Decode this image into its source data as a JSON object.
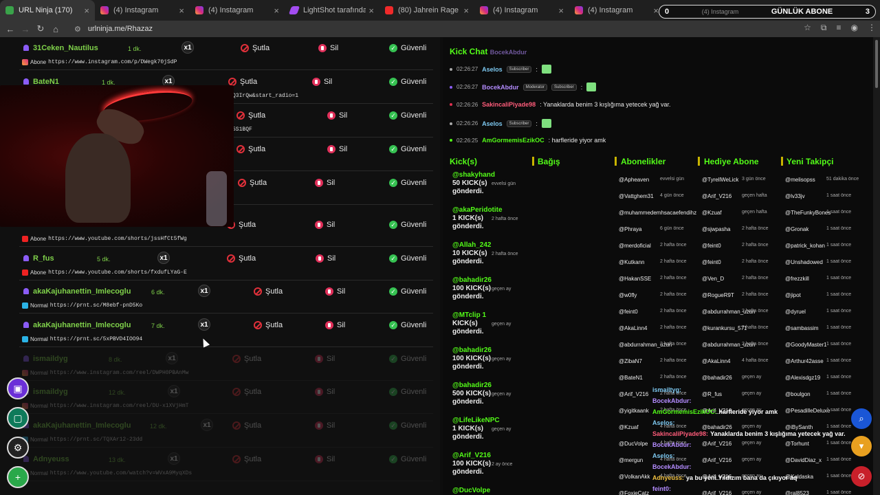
{
  "tabs": [
    {
      "title": "URL Ninja (170)",
      "fav": "un"
    },
    {
      "title": "(4) Instagram",
      "fav": "ig"
    },
    {
      "title": "(4) Instagram",
      "fav": "ig"
    },
    {
      "title": "LightShot tarafından Ekra",
      "fav": "ls"
    },
    {
      "title": "(80) Jahrein Rage | - YouT",
      "fav": "yt"
    },
    {
      "title": "(4) Instagram",
      "fav": "ig"
    },
    {
      "title": "(4) Instagram",
      "fav": "ig"
    }
  ],
  "sub_counter": {
    "left": "0",
    "label": "GÜNLÜK ABONE",
    "right": "3",
    "overlay_tab": "(4) Instagram"
  },
  "address": {
    "url": "urlninja.me/Rhazaz"
  },
  "actions": {
    "multiplier": "x1",
    "timeout": "Şutla",
    "delete": "Sil",
    "trust": "Güvenli"
  },
  "link_rows": [
    {
      "user": "31Ceken_Nautilus",
      "time": "1 dk.",
      "type": "Abone",
      "url": "https://www.instagram.com/p/DWegk70jSdP",
      "icon": "ig"
    },
    {
      "user": "BateN1",
      "time": "1 dk.",
      "type": "",
      "url": "Q3IrQw&start_radio=1",
      "icon": ""
    },
    {
      "user": "",
      "time": "",
      "type": "",
      "url": "5S1BQF",
      "icon": ""
    },
    {
      "user": "",
      "time": "",
      "type": "",
      "url": "",
      "icon": ""
    },
    {
      "user": "",
      "time": "",
      "type": "",
      "url": "",
      "icon": ""
    },
    {
      "user": "",
      "time": "",
      "type": "Abone",
      "url": "https://www.youtube.com/shorts/jssHfCt5fWg",
      "icon": "yt"
    },
    {
      "user": "R_fus",
      "time": "5 dk.",
      "type": "Abone",
      "url": "https://www.youtube.com/shorts/fxdufLYaG-E",
      "icon": "yt"
    },
    {
      "user": "akaKajuhanettin_Imlecoglu",
      "time": "6 dk.",
      "type": "Normal",
      "url": "https://prnt.sc/M8ebf-pnD5Ko",
      "icon": "pr"
    },
    {
      "user": "akaKajuhanettin_Imlecoglu",
      "time": "7 dk.",
      "type": "Normal",
      "url": "https://prnt.sc/5xPBVD4IOO94",
      "icon": "pr"
    },
    {
      "user": "ismaildyg",
      "time": "8 dk.",
      "type": "Normal",
      "url": "https://www.instagram.com/reel/DWPH0PBAnMw",
      "icon": "ig"
    },
    {
      "user": "ismaildyg",
      "time": "12 dk.",
      "type": "Normal",
      "url": "https://www.instagram.com/reel/DU-x1XVjHmT",
      "icon": "ig"
    },
    {
      "user": "akaKajuhanettin_Imlecoglu",
      "time": "12 dk.",
      "type": "Normal",
      "url": "https://prnt.sc/TQXAr12-23dd",
      "icon": "pr"
    },
    {
      "user": "Adnyeuss",
      "time": "13 dk.",
      "type": "Normal",
      "url": "https://www.youtube.com/watch?v=WVxA9MyqXDs",
      "icon": "yt"
    },
    {
      "user": "",
      "time": "",
      "type": "",
      "url": "",
      "icon": ""
    }
  ],
  "chat": {
    "title": "Kick Chat",
    "header_user": "BocekAbdur",
    "messages": [
      {
        "time": "02:26:27",
        "user": "Aselos",
        "color": "#7dc8f0",
        "badges": [
          "Subscriber"
        ],
        "text": ":",
        "emote": true,
        "dot": "#aaa"
      },
      {
        "time": "02:26:27",
        "user": "BocekAbdur",
        "color": "#b48cff",
        "badges": [
          "Moderator",
          "Subscriber"
        ],
        "text": ":",
        "emote": true,
        "dot": "#8b5cf6"
      },
      {
        "time": "02:26:26",
        "user": "SakincaliPiyade98",
        "color": "#ff5c7a",
        "badges": [],
        "text": ": Yanaklarda benim 3 kışlığıma yetecek yağ var.",
        "emote": false,
        "dot": "#e03050"
      },
      {
        "time": "02:26:26",
        "user": "Aselos",
        "color": "#7dc8f0",
        "badges": [
          "Subscriber"
        ],
        "text": ":",
        "emote": true,
        "dot": "#aaa"
      },
      {
        "time": "02:26:25",
        "user": "AmGormemisEzikOC",
        "color": "#53fc18",
        "badges": [],
        "text": ": harfleride yiyor amk",
        "emote": false,
        "dot": "#53fc18"
      }
    ]
  },
  "columns": {
    "kicks": "Kick(s)",
    "donations": "Bağış",
    "subs": "Abonelikler",
    "gift": "Hediye Abone",
    "follow": "Yeni Takipçi"
  },
  "kicks": [
    {
      "name": "@shakyhand",
      "line1": "50 KICK(s)",
      "line2": "gönderdi.",
      "time": "evvelsi gün"
    },
    {
      "name": "@akaPeridotite",
      "line1": "1 KICK(s)",
      "line2": "gönderdi.",
      "time": "2 hafta önce"
    },
    {
      "name": "@Allah_242",
      "line1": "10 KICK(s)",
      "line2": "gönderdi.",
      "time": "2 hafta önce"
    },
    {
      "name": "@bahadir26",
      "line1": "100 KICK(s)",
      "line2": "gönderdi.",
      "time": "geçen ay"
    },
    {
      "name": "@MTclip 1",
      "line1": "KICK(s)",
      "line2": "gönderdi.",
      "time": "geçen ay"
    },
    {
      "name": "@bahadir26",
      "line1": "100 KICK(s)",
      "line2": "gönderdi.",
      "time": "geçen ay"
    },
    {
      "name": "@bahadir26",
      "line1": "500 KICK(s)",
      "line2": "gönderdi.",
      "time": "geçen ay"
    },
    {
      "name": "@LifeLikeNPC",
      "line1": "1 KICK(s)",
      "line2": "gönderdi.",
      "time": "geçen ay"
    },
    {
      "name": "@Arif_V216",
      "line1": "100 KICK(s)",
      "line2": "gönderdi.",
      "time": "2 ay önce"
    },
    {
      "name": "@DucVolpe",
      "line1": "",
      "line2": "",
      "time": ""
    }
  ],
  "subs": [
    [
      "@Apheaven",
      "evvelsi gün"
    ],
    [
      "@Vattghem31",
      "4 gün önce"
    ],
    [
      "@muhammedemhsacaefendihz",
      ""
    ],
    [
      "@Phraya",
      "6 gün önce"
    ],
    [
      "@merdoficial",
      "2 hafta önce"
    ],
    [
      "@Kutkann",
      "2 hafta önce"
    ],
    [
      "@HakanSSE",
      "2 hafta önce"
    ],
    [
      "@w0fly",
      "2 hafta önce"
    ],
    [
      "@feint0",
      "2 hafta önce"
    ],
    [
      "@AkaLinn4",
      "2 hafta önce"
    ],
    [
      "@abdurrahman_uzun",
      "2 hafta önce"
    ],
    [
      "@ZibaN7",
      "2 hafta önce"
    ],
    [
      "@BateN1",
      "2 hafta önce"
    ],
    [
      "@Arif_V216",
      "2 hafta önce"
    ],
    [
      "@yigitkaank",
      "2 hafta önce"
    ],
    [
      "@Kzuaf",
      "4 hafta önce"
    ],
    [
      "@DucVolpe",
      "4 hafta önce"
    ],
    [
      "@mergun",
      "4 hafta önce"
    ],
    [
      "@VolkanAkk",
      "4 hafta önce"
    ],
    [
      "@FoxieCatz",
      ""
    ]
  ],
  "gifts": [
    [
      "@TyrellWeLick",
      "3 gün önce"
    ],
    [
      "@Arif_V216",
      "geçen hafta"
    ],
    [
      "@Kzuaf",
      "geçen hafta"
    ],
    [
      "@sjwpasha",
      "2 hafta önce"
    ],
    [
      "@feint0",
      "2 hafta önce"
    ],
    [
      "@feint0",
      "2 hafta önce"
    ],
    [
      "@Ven_D",
      "2 hafta önce"
    ],
    [
      "@RogueR9T",
      "2 hafta önce"
    ],
    [
      "@abdurrahman_uzun",
      "2 hafta önce"
    ],
    [
      "@kurankursu_571",
      "2 hafta önce"
    ],
    [
      "@abdurrahman_uzun",
      "2 hafta önce"
    ],
    [
      "@AkaLinn4",
      "4 hafta önce"
    ],
    [
      "@bahadir26",
      "geçen ay"
    ],
    [
      "@R_fus",
      "geçen ay"
    ],
    [
      "@Arif_V216",
      "geçen ay"
    ],
    [
      "@bahadir26",
      "geçen ay"
    ],
    [
      "@Arif_V216",
      "geçen ay"
    ],
    [
      "@Arif_V216",
      "geçen ay"
    ],
    [
      "@Arif_V216",
      "geçen ay"
    ],
    [
      "@Arif_V216",
      "geçen ay"
    ]
  ],
  "follows": [
    [
      "@melisopss",
      "51 dakika önce"
    ],
    [
      "@lv33jv",
      "1 saat önce"
    ],
    [
      "@TheFunkyBones",
      "1 saat önce"
    ],
    [
      "@Gronak",
      "1 saat önce"
    ],
    [
      "@patrick_kohan",
      "1 saat önce"
    ],
    [
      "@Unshadowed",
      "1 saat önce"
    ],
    [
      "@frezzkill",
      "1 saat önce"
    ],
    [
      "@jipot",
      "1 saat önce"
    ],
    [
      "@dyruel",
      "1 saat önce"
    ],
    [
      "@sambassim",
      "1 saat önce"
    ],
    [
      "@GoodyMaster1",
      "1 saat önce"
    ],
    [
      "@Arthur42asse",
      "1 saat önce"
    ],
    [
      "@Alexisdgz19",
      "1 saat önce"
    ],
    [
      "@boulgon",
      "1 saat önce"
    ],
    [
      "@PesadilleDeluxe",
      "1 saat önce"
    ],
    [
      "@iBySanth",
      "1 saat önce"
    ],
    [
      "@Torhunt",
      "1 saat önce"
    ],
    [
      "@DavidDiaz_x",
      "1 saat önce"
    ],
    [
      "@Kaldaska",
      "1 saat önce"
    ],
    [
      "@ral8523",
      "1 saat önce"
    ]
  ],
  "overlay_chat": [
    {
      "user": "ismailtyg:",
      "text": "",
      "color": "#7dc8f0"
    },
    {
      "user": "BocekAbdur:",
      "text": "",
      "color": "#b48cff"
    },
    {
      "user": "AmGormemisEzikOC:",
      "text": "harfleride yiyor amk",
      "color": "#53fc18"
    },
    {
      "user": "Aselos:",
      "text": "",
      "color": "#7dc8f0"
    },
    {
      "user": "SakincaliPiyade98:",
      "text": "Yanaklarda benim 3 kışlığıma yetecek yağ var.",
      "color": "#ff5c7a"
    },
    {
      "user": "BocekAbdur:",
      "text": "",
      "color": "#b48cff"
    },
    {
      "user": "Aselos:",
      "text": "",
      "color": "#7dc8f0"
    },
    {
      "user": "BocekAbdur:",
      "text": "",
      "color": "#b48cff"
    },
    {
      "user": "Adnyeuss:",
      "text": "ya bu yeni Yıldızım bana da çıkıyor aq",
      "color": "#f0c040"
    },
    {
      "user": "feint0:",
      "text": "",
      "color": "#b48cff"
    }
  ],
  "icons": {
    "twitch": "twitch-icon",
    "kick": "kick-icon",
    "settings": "gear-icon",
    "add_user": "add-user-icon",
    "search": "search-icon"
  },
  "colors": {
    "accent": "#53fc18",
    "danger": "#e0303a",
    "ok": "#36c252"
  }
}
